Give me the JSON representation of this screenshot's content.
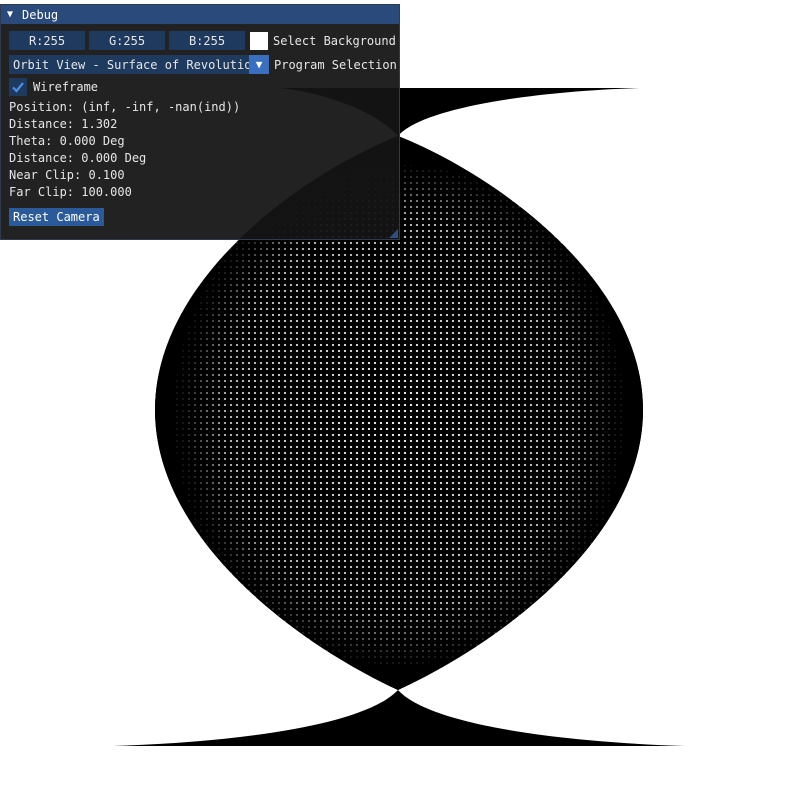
{
  "debug": {
    "title": "Debug",
    "color": {
      "r": "R:255",
      "g": "G:255",
      "b": "B:255",
      "swatch": "#ffffff"
    },
    "select_background_label": "Select Background",
    "program": {
      "selected": "Orbit View - Surface of Revolution",
      "label": "Program Selection"
    },
    "wireframe": {
      "label": "Wireframe",
      "checked": true
    },
    "position": "Position: (inf, -inf, -nan(ind))",
    "distance": "Distance: 1.302",
    "theta": "Theta: 0.000 Deg",
    "phi": "Distance: 0.000 Deg",
    "near_clip": "Near Clip: 0.100",
    "far_clip": "Far Clip: 100.000",
    "reset_label": "Reset Camera"
  },
  "colors": {
    "background": "#ffffff",
    "mesh": "#000000",
    "title_bar": "#294a7a",
    "frame_bg": "#1f3a5f",
    "button": "#2a5a9a"
  }
}
